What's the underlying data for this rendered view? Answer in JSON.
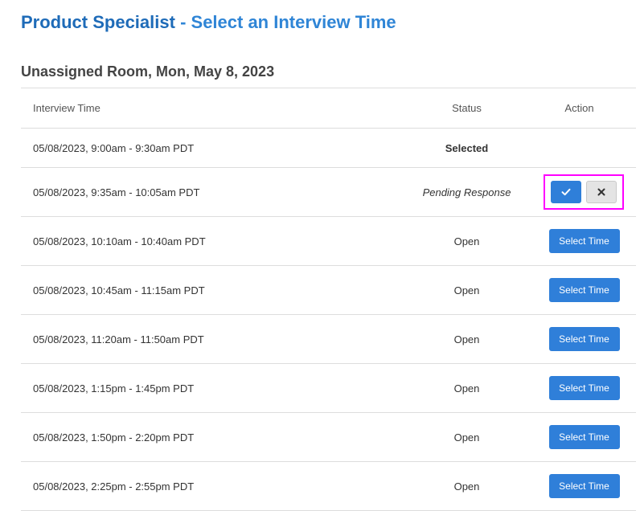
{
  "header": {
    "job_title": "Product Specialist",
    "separator": " - ",
    "action_text": "Select an Interview Time"
  },
  "section": {
    "heading": "Unassigned Room, Mon, May 8, 2023"
  },
  "table": {
    "columns": {
      "time": "Interview Time",
      "status": "Status",
      "action": "Action"
    },
    "rows": [
      {
        "time": "05/08/2023, 9:00am - 9:30am PDT",
        "status": "Selected"
      },
      {
        "time": "05/08/2023, 9:35am - 10:05am PDT",
        "status": "Pending Response"
      },
      {
        "time": "05/08/2023, 10:10am - 10:40am PDT",
        "status": "Open",
        "action": "Select Time"
      },
      {
        "time": "05/08/2023, 10:45am - 11:15am PDT",
        "status": "Open",
        "action": "Select Time"
      },
      {
        "time": "05/08/2023, 11:20am - 11:50am PDT",
        "status": "Open",
        "action": "Select Time"
      },
      {
        "time": "05/08/2023, 1:15pm - 1:45pm PDT",
        "status": "Open",
        "action": "Select Time"
      },
      {
        "time": "05/08/2023, 1:50pm - 2:20pm PDT",
        "status": "Open",
        "action": "Select Time"
      },
      {
        "time": "05/08/2023, 2:25pm - 2:55pm PDT",
        "status": "Open",
        "action": "Select Time"
      }
    ]
  },
  "icons": {
    "accept": "checkmark-icon",
    "decline": "close-icon"
  },
  "colors": {
    "brand_dark": "#1e6bb8",
    "brand": "#2f85d6",
    "button": "#2f7fd9",
    "highlight": "#ff00ff"
  }
}
